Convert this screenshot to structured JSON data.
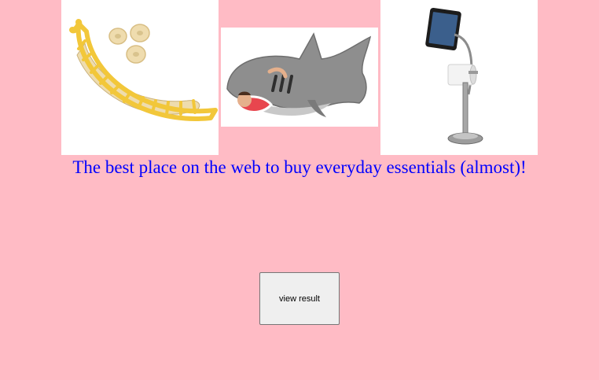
{
  "products": [
    {
      "name": "banana slicer",
      "icon": "banana-slicer-image"
    },
    {
      "name": "shark sleeping bag",
      "icon": "shark-sleeping-bag-image"
    },
    {
      "name": "tablet toilet paper stand",
      "icon": "tablet-stand-image"
    }
  ],
  "tagline": {
    "text": "The best place on the web to buy everyday essentials (almost)!",
    "color": "#0000ff"
  },
  "button": {
    "label": "view result"
  },
  "colors": {
    "background": "#ffbbc5",
    "button_background": "#efefef"
  }
}
